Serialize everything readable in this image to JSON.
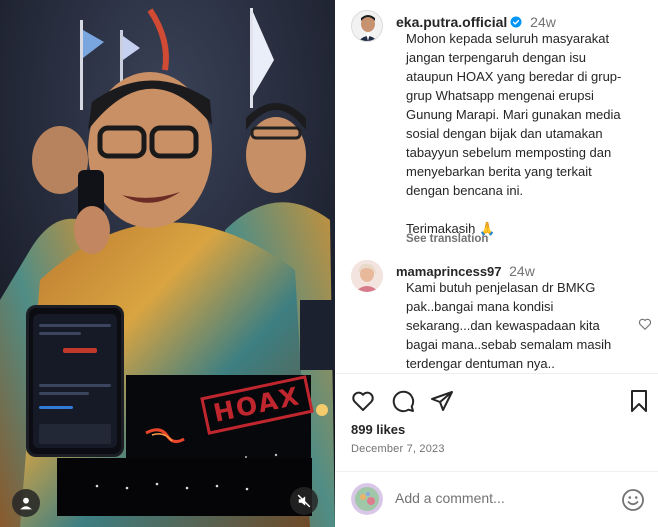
{
  "post": {
    "author": {
      "username": "eka.putra.official",
      "verified": true,
      "time_ago": "24w"
    },
    "caption_lines": [
      "Mohon kepada seluruh masyarakat",
      "jangan terpengaruh dengan isu",
      "ataupun HOAX yang beredar di grup-",
      "grup Whatsapp mengenai erupsi",
      "Gunung Marapi. Mari gunakan media",
      "sosial dengan bijak dan utamakan",
      "tabayyun sebelum memposting dan",
      "menyebarkan berita yang terkait",
      "dengan bencana ini.",
      "",
      "Terimakasih 🙏"
    ],
    "see_translation": "See translation",
    "comment": {
      "username": "mamaprincess97",
      "time_ago": "24w",
      "text_lines": [
        "Kami butuh penjelasan dr BMKG",
        "pak..bangai mana kondisi",
        "sekarang...dan kewaspadaan kita",
        "bagai mana..sebab semalam masih",
        "terdengar dentuman nya.."
      ]
    },
    "likes": "899 likes",
    "date": "December 7, 2023",
    "add_comment_placeholder": "Add a comment...",
    "media": {
      "stamp_text": "HOAX"
    }
  },
  "icons": {
    "like": "heart-outline-icon",
    "comment": "speech-bubble-icon",
    "share": "paper-plane-icon",
    "save": "bookmark-icon",
    "emoji": "smiley-icon",
    "mute": "speaker-muted-icon",
    "tagged_users": "person-icon"
  },
  "colors": {
    "verified": "#0095f6",
    "stamp": "#c0262d",
    "secondary_text": "#737373"
  }
}
